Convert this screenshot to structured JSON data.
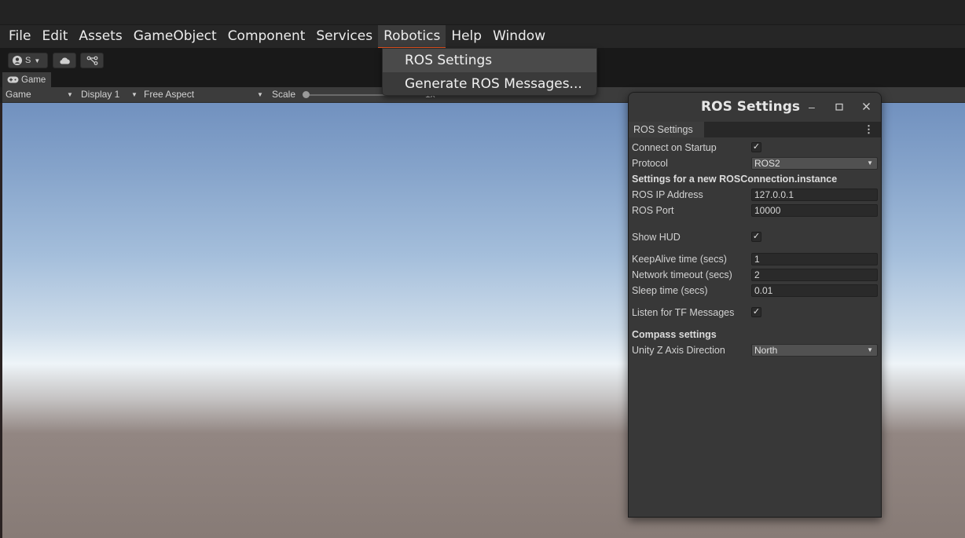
{
  "menu": {
    "items": [
      {
        "label": "File"
      },
      {
        "label": "Edit"
      },
      {
        "label": "Assets"
      },
      {
        "label": "GameObject"
      },
      {
        "label": "Component"
      },
      {
        "label": "Services"
      },
      {
        "label": "Robotics"
      },
      {
        "label": "Help"
      },
      {
        "label": "Window"
      }
    ],
    "active": "Robotics"
  },
  "robotics_menu": {
    "items": [
      "ROS Settings",
      "Generate ROS Messages..."
    ]
  },
  "toolbar": {
    "account_label": "S",
    "icons": [
      "account-icon",
      "cloud-icon",
      "collab-icon"
    ]
  },
  "game_view": {
    "tab_label": "Game",
    "view_select": "Game",
    "display_select": "Display 1",
    "aspect_select": "Free Aspect",
    "scale_label": "Scale",
    "scale_value": "1x"
  },
  "ros_window": {
    "title": "ROS Settings",
    "tab": "ROS Settings",
    "connect_on_startup_label": "Connect on Startup",
    "connect_on_startup": true,
    "protocol_label": "Protocol",
    "protocol_value": "ROS2",
    "new_instance_header": "Settings for a new ROSConnection.instance",
    "ip_label": "ROS IP Address",
    "ip_value": "127.0.0.1",
    "port_label": "ROS Port",
    "port_value": "10000",
    "show_hud_label": "Show HUD",
    "show_hud": true,
    "keepalive_label": "KeepAlive time (secs)",
    "keepalive_value": "1",
    "network_timeout_label": "Network timeout (secs)",
    "network_timeout_value": "2",
    "sleep_label": "Sleep time (secs)",
    "sleep_value": "0.01",
    "listen_tf_label": "Listen for TF Messages",
    "listen_tf": true,
    "compass_header": "Compass settings",
    "z_axis_label": "Unity Z Axis Direction",
    "z_axis_value": "North"
  },
  "colors": {
    "menu_accent": "#e95420",
    "panel_bg": "#383838",
    "sky_top": "#7191bf",
    "ground": "#877b76"
  }
}
